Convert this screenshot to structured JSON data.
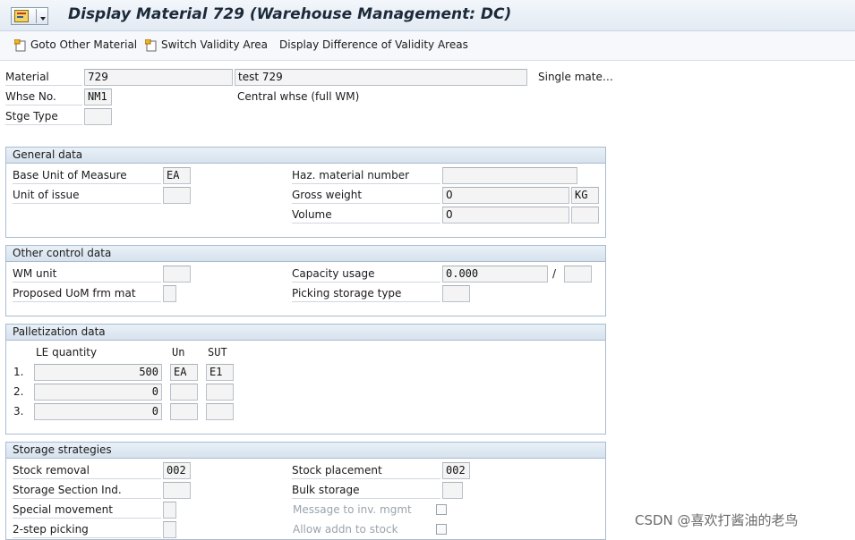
{
  "window": {
    "title": "Display Material 729 (Warehouse Management: DC)"
  },
  "toolbar": {
    "goto_other_material": "Goto Other Material",
    "switch_validity_area": "Switch Validity Area",
    "display_difference": "Display Difference of Validity Areas"
  },
  "header": {
    "material_label": "Material",
    "material_value": "729",
    "material_desc": "test 729",
    "single_material": "Single mate…",
    "whse_label": "Whse No.",
    "whse_value": "NM1",
    "whse_desc": "Central whse (full WM)",
    "stge_type_label": "Stge Type",
    "stge_type_value": ""
  },
  "general": {
    "title": "General data",
    "base_uom_label": "Base Unit of Measure",
    "base_uom_value": "EA",
    "unit_issue_label": "Unit of issue",
    "unit_issue_value": "",
    "haz_label": "Haz. material number",
    "haz_value": "",
    "gross_weight_label": "Gross weight",
    "gross_weight_value": "0",
    "gross_weight_unit": "KG",
    "volume_label": "Volume",
    "volume_value": "0",
    "volume_unit": ""
  },
  "control": {
    "title": "Other control data",
    "wm_unit_label": "WM unit",
    "wm_unit_value": "",
    "proposed_uom_label": "Proposed UoM frm mat",
    "proposed_uom_checked": false,
    "capacity_label": "Capacity usage",
    "capacity_value": "0.000",
    "capacity_sep": "/",
    "capacity_unit": "",
    "picking_st_label": "Picking storage type",
    "picking_st_value": ""
  },
  "palletization": {
    "title": "Palletization data",
    "col_le_qty": "LE quantity",
    "col_un": "Un",
    "col_sut": "SUT",
    "rows": [
      {
        "num": "1.",
        "qty": "500",
        "un": "EA",
        "sut": "E1"
      },
      {
        "num": "2.",
        "qty": "0",
        "un": "",
        "sut": ""
      },
      {
        "num": "3.",
        "qty": "0",
        "un": "",
        "sut": ""
      }
    ]
  },
  "storage": {
    "title": "Storage strategies",
    "stock_removal_label": "Stock removal",
    "stock_removal_value": "002",
    "storage_section_label": "Storage Section Ind.",
    "storage_section_value": "",
    "special_movement_label": "Special movement",
    "special_movement_value": "",
    "two_step_label": "2-step picking",
    "two_step_value": "",
    "stock_placement_label": "Stock placement",
    "stock_placement_value": "002",
    "bulk_storage_label": "Bulk storage",
    "bulk_storage_value": "",
    "msg_inv_label": "Message to inv. mgmt",
    "msg_inv_checked": false,
    "allow_addn_label": "Allow addn to stock",
    "allow_addn_checked": false
  },
  "watermark": "CSDN @喜欢打酱油的老鸟"
}
